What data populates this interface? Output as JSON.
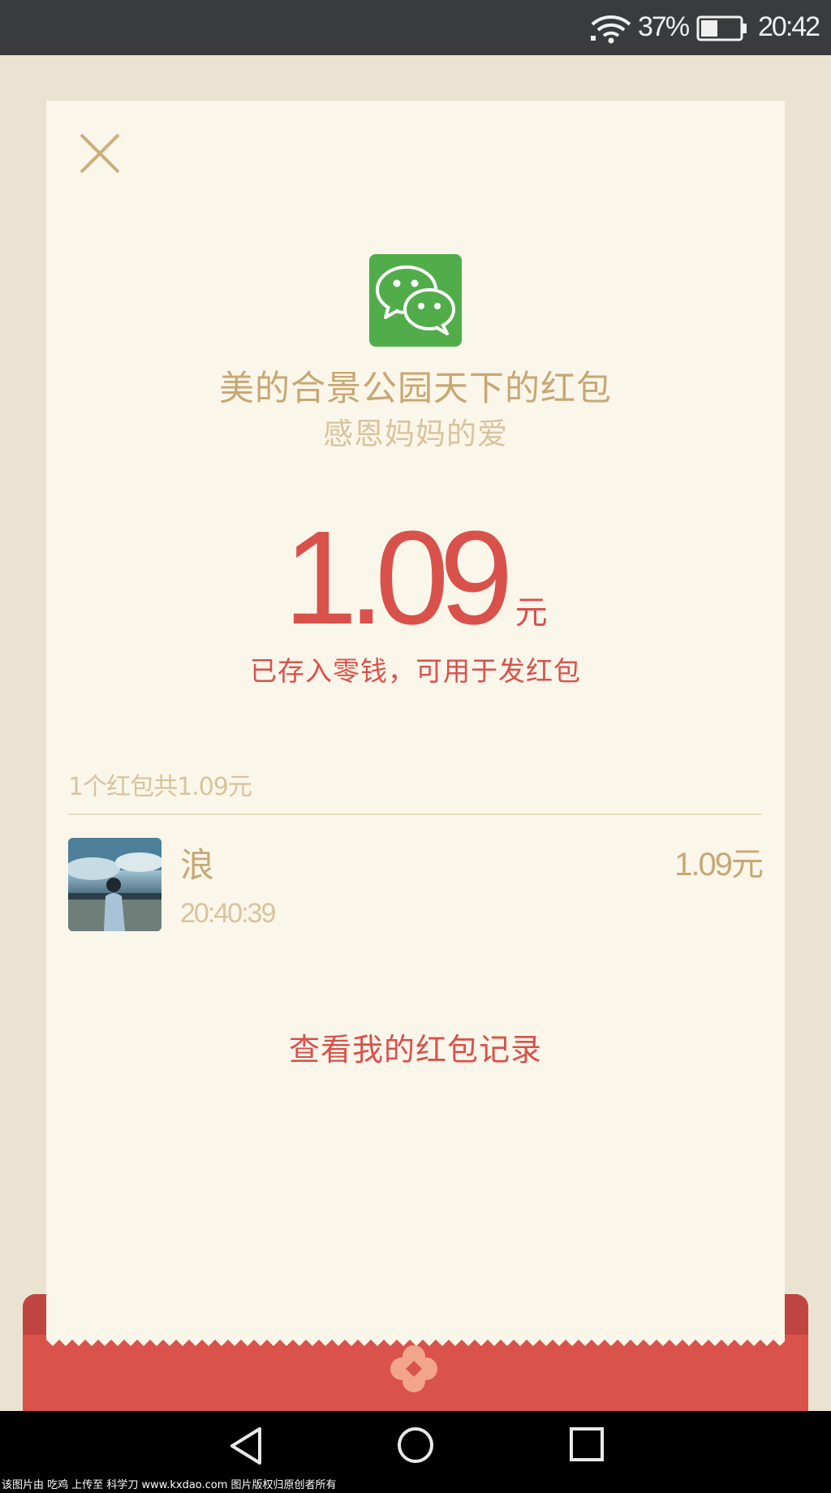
{
  "status_bar": {
    "battery_percent": "37%",
    "time": "20:42",
    "icons": [
      "wifi-icon",
      "battery-icon"
    ]
  },
  "envelope": {
    "title": "美的合景公园天下的红包",
    "greeting": "感恩妈妈的爱",
    "amount": "1.09",
    "unit": "元",
    "stored_note": "已存入零钱，可用于发红包"
  },
  "summary": "1个红包共1.09元",
  "receivers": [
    {
      "name": "浪",
      "time": "20:40:39",
      "amount": "1.09元"
    }
  ],
  "records_link": "查看我的红包记录",
  "navigation": {
    "icons": [
      "back-icon",
      "home-icon",
      "recent-apps-icon"
    ]
  },
  "watermark": "该图片由 吃鸡 上传至 科学刀 www.kxdao.com 图片版权归原创者所有",
  "colors": {
    "accent_red": "#d9514b",
    "gold_text": "#c8a774",
    "light_gold_text": "#d8c39e",
    "card_bg": "#fbf6ea",
    "page_bg": "#ebe3d1",
    "wechat_green": "#51ad4a"
  }
}
